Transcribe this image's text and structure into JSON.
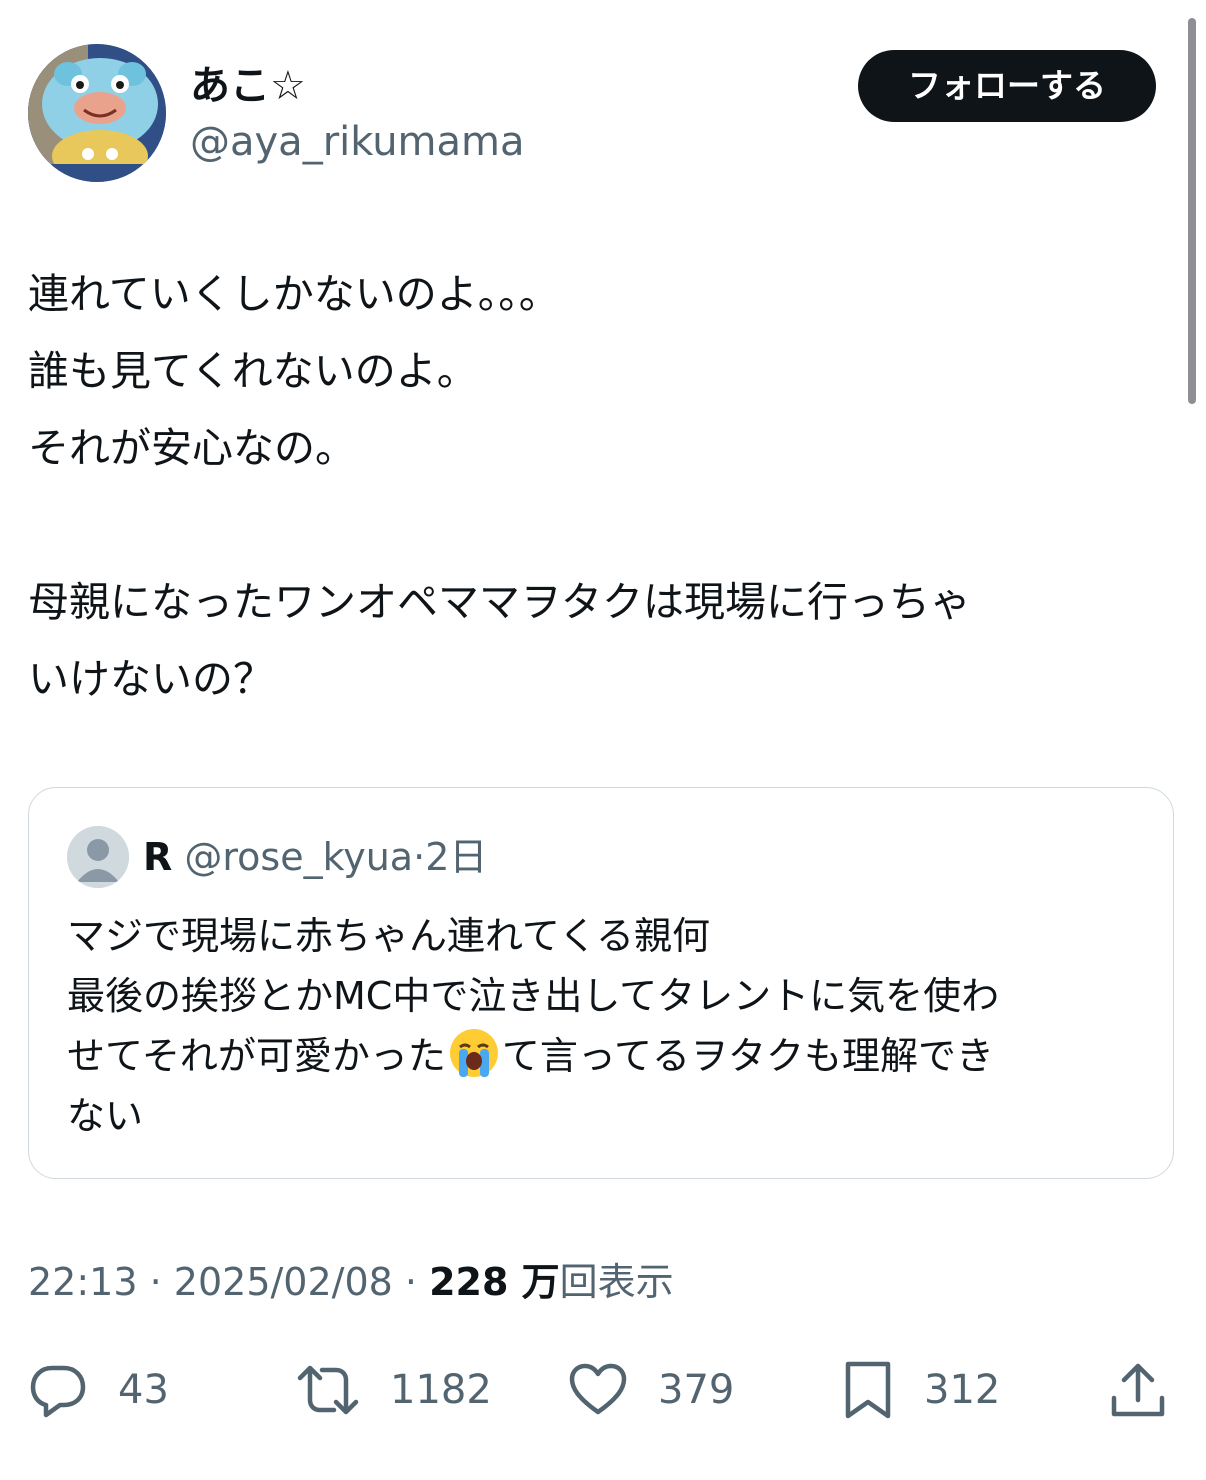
{
  "author": {
    "display_name": "あこ☆",
    "handle": "@aya_rikumama",
    "follow_label": "フォローする"
  },
  "tweet": {
    "lines": [
      "連れていくしかないのよ。。。",
      "誰も見てくれないのよ。",
      "それが安心なの。",
      "",
      "母親になったワンオペママヲタクは現場に行っちゃ",
      "いけないの？"
    ]
  },
  "quote": {
    "name": "R",
    "handle": "@rose_kyua",
    "separator": "·",
    "time": "2日",
    "lines": [
      "マジで現場に赤ちゃん連れてくる親何",
      "最後の挨拶とかMC中で泣き出してタレントに気を使わ",
      "せてそれが可愛かった",
      "て言ってるヲタクも理解でき",
      "ない"
    ],
    "emoji": "loudly-crying-face"
  },
  "meta": {
    "time": "22:13",
    "sep1": "·",
    "date": "2025/02/08",
    "sep2": "·",
    "views_number": "228 万",
    "views_label": "回表示"
  },
  "actions": {
    "replies": "43",
    "retweets": "1182",
    "likes": "379",
    "bookmarks": "312"
  },
  "icons": {
    "reply": "reply-icon",
    "retweet": "retweet-icon",
    "like": "heart-icon",
    "bookmark": "bookmark-icon",
    "share": "share-icon"
  },
  "colors": {
    "text": "#0f1419",
    "secondary": "#536471",
    "button_bg": "#0f1419",
    "border": "#cfd9de"
  }
}
